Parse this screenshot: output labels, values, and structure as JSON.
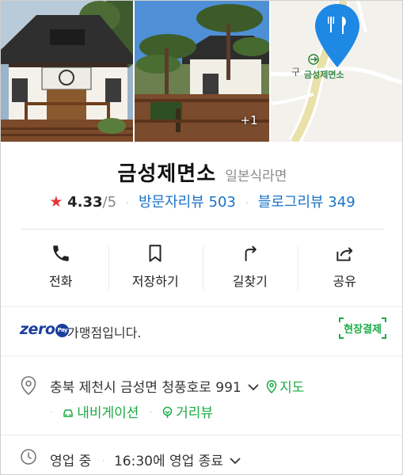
{
  "photos": {
    "more_count": "+1"
  },
  "map": {
    "place_label": "금성제면소"
  },
  "place": {
    "name": "금성제면소",
    "category": "일본식라면",
    "rating": "4.33",
    "rating_max": "/5",
    "visitor_reviews": "방문자리뷰 503",
    "blog_reviews": "블로그리뷰 349"
  },
  "actions": [
    {
      "label": "전화",
      "icon": "phone-icon"
    },
    {
      "label": "저장하기",
      "icon": "bookmark-icon"
    },
    {
      "label": "길찾기",
      "icon": "directions-icon"
    },
    {
      "label": "공유",
      "icon": "share-icon"
    }
  ],
  "zeropay": {
    "logo_text": "zero",
    "badge_text": "Pay",
    "text": "가맹점입니다.",
    "onsite_badge": "현장결제"
  },
  "address": {
    "text": "충북 제천시 금성면 청풍호로 991",
    "map_link": "지도",
    "navigation_link": "내비게이션",
    "street_view_link": "거리뷰"
  },
  "hours": {
    "status": "영업 중",
    "closing": "16:30에 영업 종료"
  },
  "colors": {
    "accent_blue": "#1a73c8",
    "accent_green": "#1bab45",
    "star_red": "#e53935",
    "zeropay_blue": "#1d3f9e",
    "map_pin_blue": "#1e88e5"
  }
}
